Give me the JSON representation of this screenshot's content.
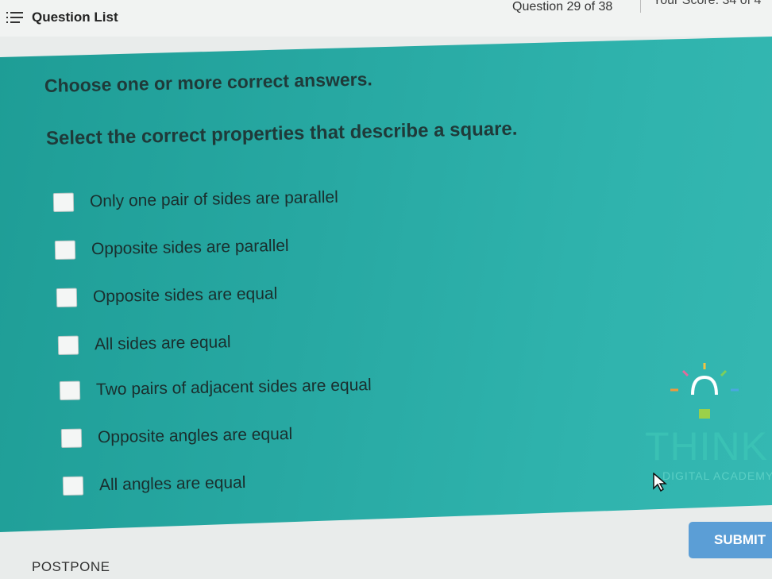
{
  "header": {
    "question_list_label": "Question List",
    "question_counter": "Question 29 of 38",
    "score_text": "Your Score: 34 of 4"
  },
  "question": {
    "instruction": "Choose one or more correct answers.",
    "prompt": "Select the correct properties that describe a square.",
    "options": [
      {
        "label": "Only one pair of sides are parallel",
        "checked": false
      },
      {
        "label": "Opposite sides are parallel",
        "checked": false
      },
      {
        "label": "Opposite sides are equal",
        "checked": false
      },
      {
        "label": "All sides are equal",
        "checked": false
      },
      {
        "label": "Two pairs of adjacent sides are equal",
        "checked": false
      },
      {
        "label": "Opposite angles are equal",
        "checked": false
      },
      {
        "label": "All angles are equal",
        "checked": false
      }
    ]
  },
  "logo": {
    "word": "THINK",
    "tagline": "DIGITAL ACADEMY"
  },
  "footer": {
    "postpone_label": "POSTPONE",
    "submit_label": "SUBMIT"
  },
  "colors": {
    "panel": "#27a8a2",
    "submit": "#5b9ed6",
    "text_dark": "#1f3a39"
  },
  "icons": [
    "list-icon",
    "checkbox-icon",
    "lightbulb-icon",
    "cursor-icon"
  ]
}
